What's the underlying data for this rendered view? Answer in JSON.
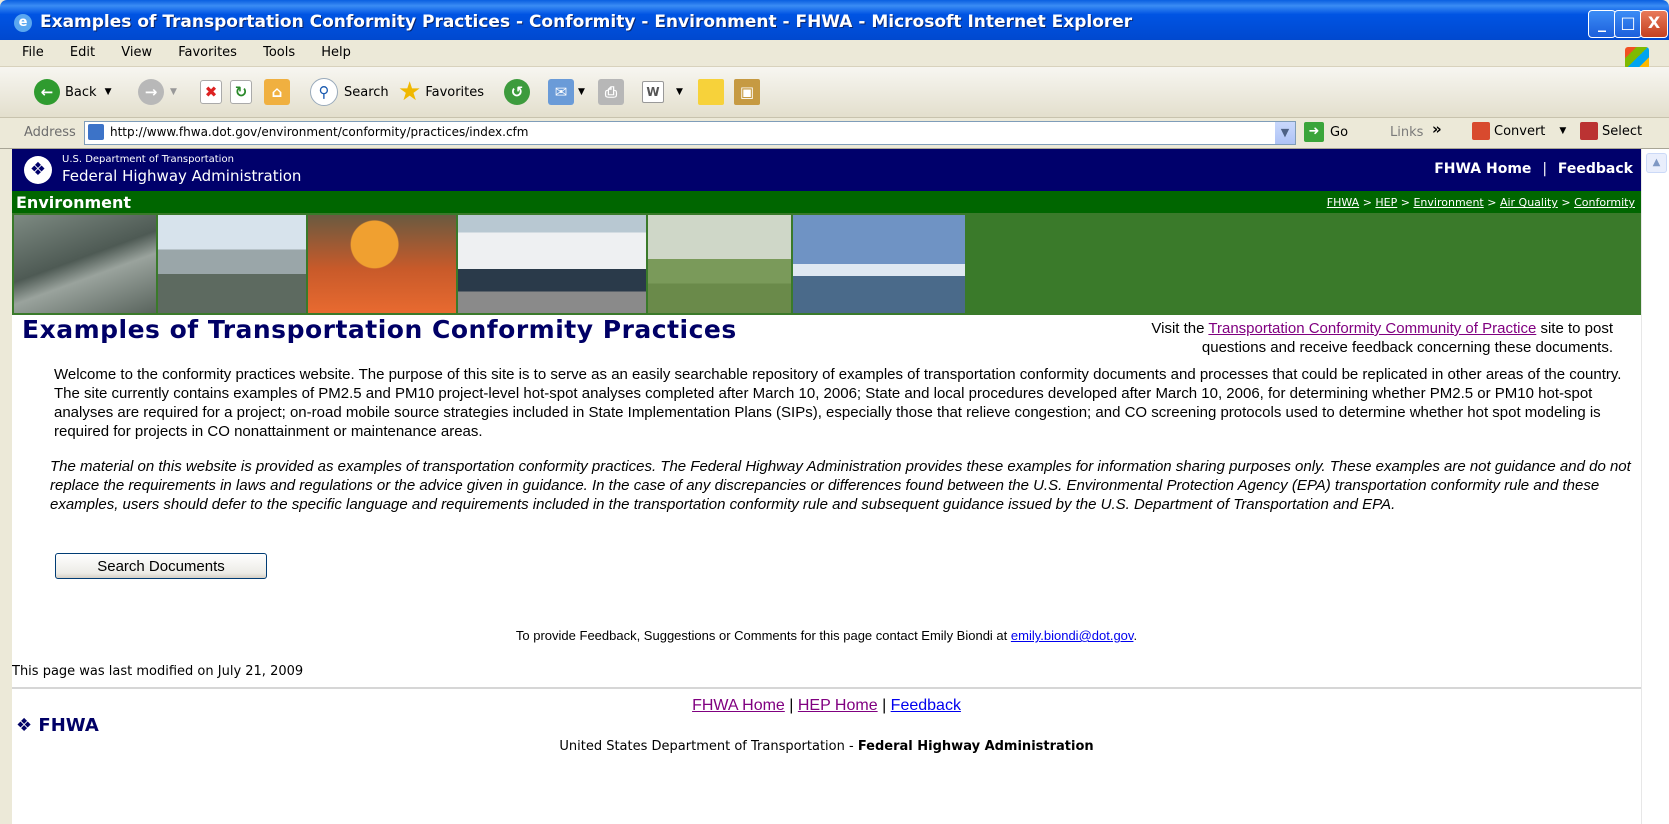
{
  "window": {
    "title": "Examples of Transportation Conformity Practices - Conformity - Environment - FHWA - Microsoft Internet Explorer",
    "controls": [
      "_",
      "□",
      "X"
    ]
  },
  "menubar": {
    "items": [
      "File",
      "Edit",
      "View",
      "Favorites",
      "Tools",
      "Help"
    ]
  },
  "toolbar": {
    "back": "Back",
    "search": "Search",
    "favorites": "Favorites"
  },
  "addressbar": {
    "label": "Address",
    "url": "http://www.fhwa.dot.gov/environment/conformity/practices/index.cfm",
    "go": "Go",
    "links": "Links",
    "chevron": "»",
    "convert": "Convert",
    "select": "Select"
  },
  "site_header": {
    "dept_small": "U.S. Department of Transportation",
    "agency": "Federal Highway Administration",
    "fhwa_home": "FHWA Home",
    "separator": "|",
    "feedback": "Feedback"
  },
  "subheader": {
    "section": "Environment",
    "breadcrumbs": [
      "FHWA",
      "HEP",
      "Environment",
      "Air Quality",
      "Conformity"
    ],
    "crumb_sep": ">"
  },
  "banner": {
    "photos": [
      "highway-interchange-photo",
      "highway-traffic-photo",
      "construction-barrel-photo",
      "bus-photo",
      "cyclist-photo",
      "bridge-photo"
    ]
  },
  "main": {
    "title": "Examples of Transportation Conformity Practices",
    "visit_prefix": "Visit the",
    "visit_link": "Transportation Conformity Community of Practice",
    "visit_suffix": "site to post questions and receive feedback concerning these documents.",
    "welcome": "Welcome to the conformity practices website. The purpose of this site is to serve as an easily searchable repository of examples of transportation conformity documents and processes that could be replicated in other areas of the country. The site currently contains examples of PM2.5 and PM10 project-level hot-spot analyses completed after March 10, 2006; State and local procedures developed after March 10, 2006, for determining whether PM2.5 or PM10 hot-spot analyses are required for a project; on-road mobile source strategies included in State Implementation Plans (SIPs), especially those that relieve congestion; and CO screening protocols used to determine whether hot spot modeling is required for projects in CO nonattainment or maintenance areas.",
    "disclaimer": "The material on this website is provided as examples of transportation conformity practices. The Federal Highway Administration provides these examples for information sharing purposes only. These examples are not guidance and do not replace the requirements in laws and regulations or the advice given in guidance. In the case of any discrepancies or differences found between the U.S. Environmental Protection Agency (EPA) transportation conformity rule and these examples, users should defer to the specific language and requirements included in the transportation conformity rule and subsequent guidance issued by the U.S. Department of Transportation and EPA.",
    "search_button": "Search Documents",
    "feedback_prefix": "To provide Feedback, Suggestions or Comments for this page contact Emily Biondi at",
    "feedback_email": "emily.biondi@dot.gov",
    "feedback_end": "."
  },
  "footer": {
    "modified": "This page was last modified on July 21, 2009",
    "links": [
      "FHWA Home",
      "HEP Home",
      "Feedback"
    ],
    "link_sep": "|",
    "logo_text": "FHWA",
    "usdot_prefix": "United States Department of Transportation -",
    "usdot_bold": "Federal Highway Administration"
  },
  "colors": {
    "header_navy": "#00006b",
    "header_green": "#006600",
    "banner_green": "#3a7a2a",
    "title_blue": "#000066",
    "visited_link": "#800080"
  }
}
